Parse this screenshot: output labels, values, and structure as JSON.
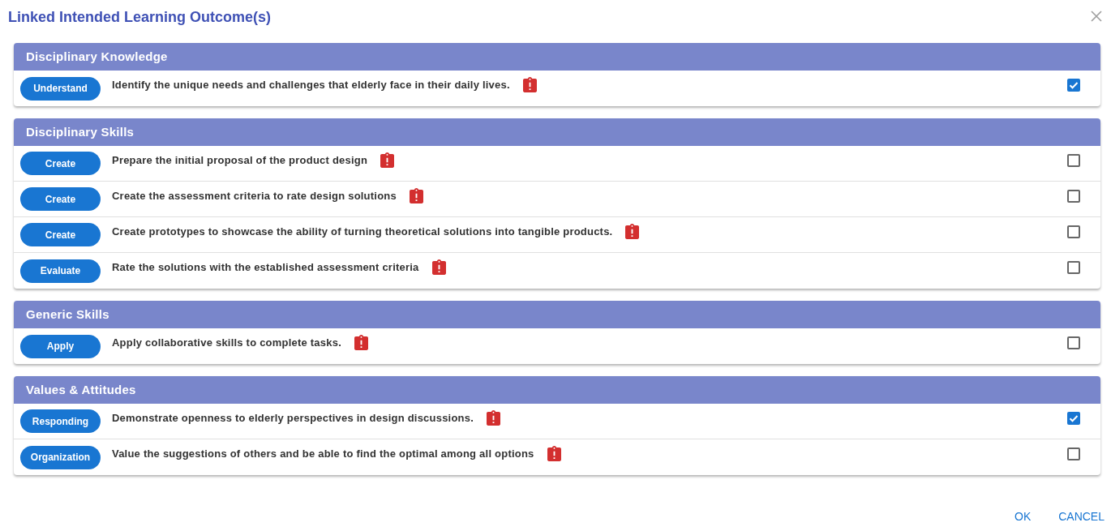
{
  "dialog": {
    "title": "Linked Intended Learning Outcome(s)"
  },
  "sections": [
    {
      "heading": "Disciplinary Knowledge",
      "outcomes": [
        {
          "tag": "Understand",
          "text": "Identify the unique needs and challenges that elderly face in their daily lives.",
          "checked": true
        }
      ]
    },
    {
      "heading": "Disciplinary Skills",
      "outcomes": [
        {
          "tag": "Create",
          "text": "Prepare the initial proposal of the product design",
          "checked": false
        },
        {
          "tag": "Create",
          "text": "Create the assessment criteria to rate design solutions",
          "checked": false
        },
        {
          "tag": "Create",
          "text": "Create prototypes to showcase the ability of turning theoretical solutions into tangible products.",
          "checked": false
        },
        {
          "tag": "Evaluate",
          "text": "Rate the solutions with the established assessment criteria",
          "checked": false
        }
      ]
    },
    {
      "heading": "Generic Skills",
      "outcomes": [
        {
          "tag": "Apply",
          "text": "Apply collaborative skills to complete tasks.",
          "checked": false
        }
      ]
    },
    {
      "heading": "Values & Attitudes",
      "outcomes": [
        {
          "tag": "Responding",
          "text": "Demonstrate openness to elderly perspectives in design discussions.",
          "checked": true
        },
        {
          "tag": "Organization",
          "text": "Value the suggestions of others and be able to find the optimal among all options",
          "checked": false
        }
      ]
    }
  ],
  "buttons": [
    {
      "label": "OK"
    },
    {
      "label": "CANCEL"
    }
  ]
}
